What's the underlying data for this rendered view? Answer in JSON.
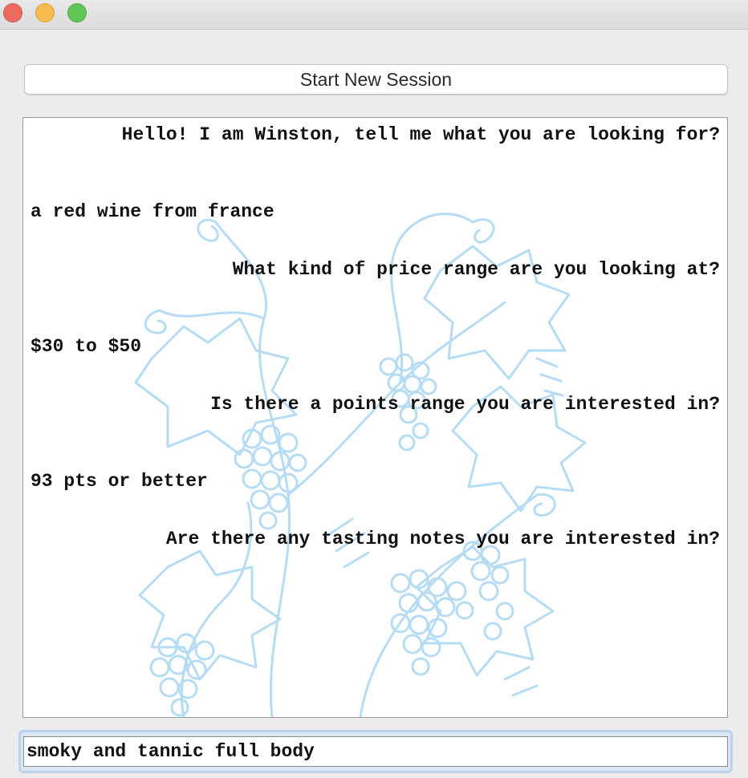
{
  "window": {
    "buttons": [
      "close-icon",
      "minimize-icon",
      "zoom-icon"
    ],
    "colors": {
      "close": "#ee6a5f",
      "minimize": "#f5bd4f",
      "zoom": "#61c454"
    }
  },
  "toolbar": {
    "start_label": "Start New Session"
  },
  "chat": {
    "messages": [
      {
        "role": "bot",
        "text": "Hello! I am Winston, tell me what you are looking for?"
      },
      {
        "role": "user",
        "text": "a red wine from france"
      },
      {
        "role": "bot",
        "text": "What kind of price range are you looking at?"
      },
      {
        "role": "user",
        "text": "$30 to $50"
      },
      {
        "role": "bot",
        "text": "Is there a points range you are interested in?"
      },
      {
        "role": "user",
        "text": "93 pts or better"
      },
      {
        "role": "bot",
        "text": "Are there any tasting notes you are interested in?"
      }
    ],
    "background_art": "grapevine-illustration",
    "art_color": "#a9d6f2"
  },
  "input": {
    "value": "smoky and tannic full body"
  }
}
